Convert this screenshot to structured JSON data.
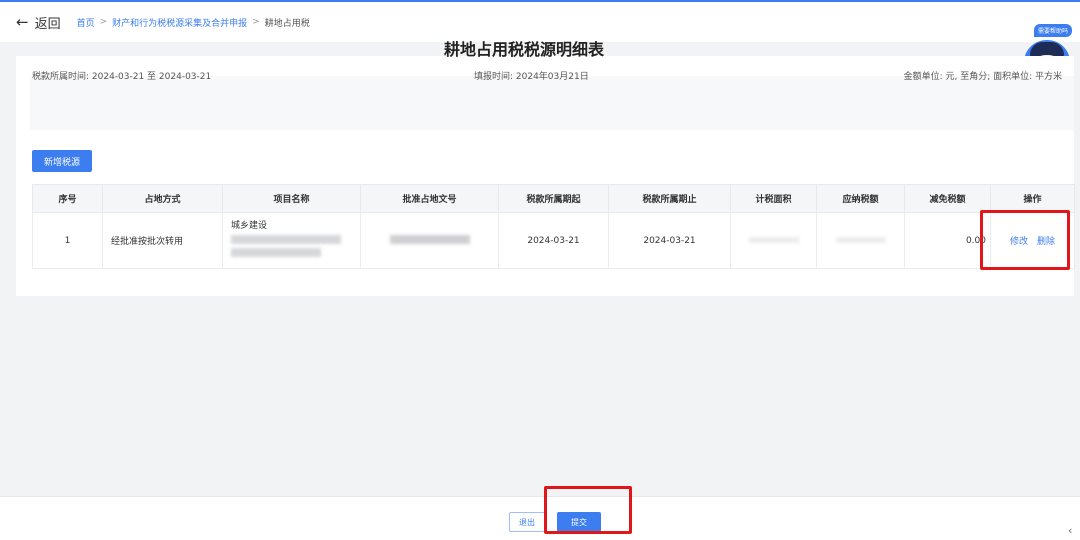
{
  "topbar": {
    "back_icon": "←",
    "back_label": "返回",
    "breadcrumb": {
      "home": "首页",
      "parent": "财产和行为税税源采集及合并申报",
      "current": "耕地占用税",
      "separator": ">"
    }
  },
  "assistant": {
    "tag": "需要帮助吗"
  },
  "form": {
    "title": "耕地占用税税源明细表",
    "period_label": "税款所属时间: 2024-03-21 至 2024-03-21",
    "fill_date_label": "填报时间: 2024年03月21日",
    "unit_label": "金额单位: 元, 至角分; 面积单位: 平方米",
    "add_button": "新增税源"
  },
  "table": {
    "headers": [
      "序号",
      "占地方式",
      "项目名称",
      "批准占地文号",
      "税款所属期起",
      "税款所属期止",
      "计税面积",
      "应纳税额",
      "减免税额",
      "操作"
    ],
    "rows": [
      {
        "index": "1",
        "occupy_type": "经批准按批次转用",
        "project_name": "城乡建设",
        "period_start": "2024-03-21",
        "period_end": "2024-03-21",
        "exempt_amount": "0.00",
        "edit_label": "修改",
        "delete_label": "删除"
      }
    ]
  },
  "footer": {
    "exit_label": "退出",
    "submit_label": "提交"
  },
  "colors": {
    "primary": "#3c7df0",
    "highlight": "#e0161b"
  }
}
